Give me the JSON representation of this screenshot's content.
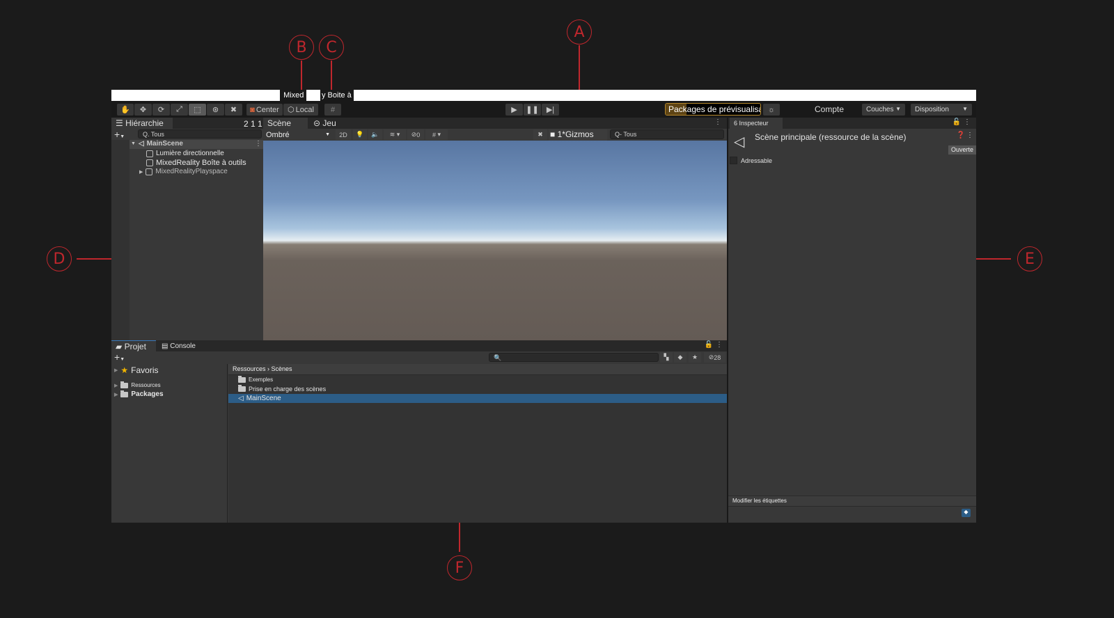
{
  "callouts": [
    {
      "label": "A"
    },
    {
      "label": "B"
    },
    {
      "label": "C"
    },
    {
      "label": "D"
    },
    {
      "label": "E"
    },
    {
      "label": "F"
    }
  ],
  "menubar": {
    "visible_fragment_1": "Mixed R",
    "visible_fragment_2": "y Boite à"
  },
  "toolbar": {
    "tools": [
      "hand-tool",
      "move-tool",
      "rotate-tool",
      "scale-tool",
      "rect-tool",
      "transform-tool",
      "custom-tool"
    ],
    "pivot_label": "Center",
    "space_label": "Local",
    "preview_packages_label": "Packages de prévisualisation en cours d'utilisation",
    "account_label": "Compte",
    "layers_label": "Couches",
    "layout_label": "Disposition"
  },
  "hierarchy": {
    "tab_label": "Hiérarchie",
    "search_placeholder": "Q. Tous",
    "scene_name": "MainScene",
    "items": [
      {
        "label": "Lumière directionnelle",
        "expandable": false
      },
      {
        "label": "MixedReality Boîte à outils",
        "expandable": false
      },
      {
        "label": "MixedRealityPlayspace",
        "expandable": true
      }
    ]
  },
  "scene_view": {
    "tab_prefix": "2 1 1",
    "tab_label": "Scène",
    "game_tab_label": "Jeu",
    "shading_mode": "Ombré",
    "btn_2d": "2D",
    "hidden_count": "0",
    "gizmos_label": "1*Gizmos",
    "search_placeholder": "Q- Tous"
  },
  "inspector": {
    "tab_label": "6 Inspecteur",
    "title": "Scène principale (ressource de la scène)",
    "open_button": "Ouverte",
    "addressable_label": "Adressable",
    "addressable_checked": false,
    "labels_section": "Modifier les étiquettes"
  },
  "project": {
    "tab_label": "Projet",
    "console_tab_label": "Console",
    "hidden_count": "28",
    "favorites_label": "Favoris",
    "tree": [
      {
        "label": "Ressources"
      },
      {
        "label": "Packages"
      }
    ],
    "breadcrumb": "Ressources › Scènes",
    "files": [
      {
        "label": "Exemples",
        "type": "folder",
        "selected": false
      },
      {
        "label": "Prise en charge des scènes",
        "type": "folder",
        "selected": false
      },
      {
        "label": "MainScene",
        "type": "scene",
        "selected": true
      }
    ]
  },
  "colors": {
    "callout": "#c0272d",
    "selection": "#2c5d87",
    "preview_badge": "#e6a21c"
  }
}
